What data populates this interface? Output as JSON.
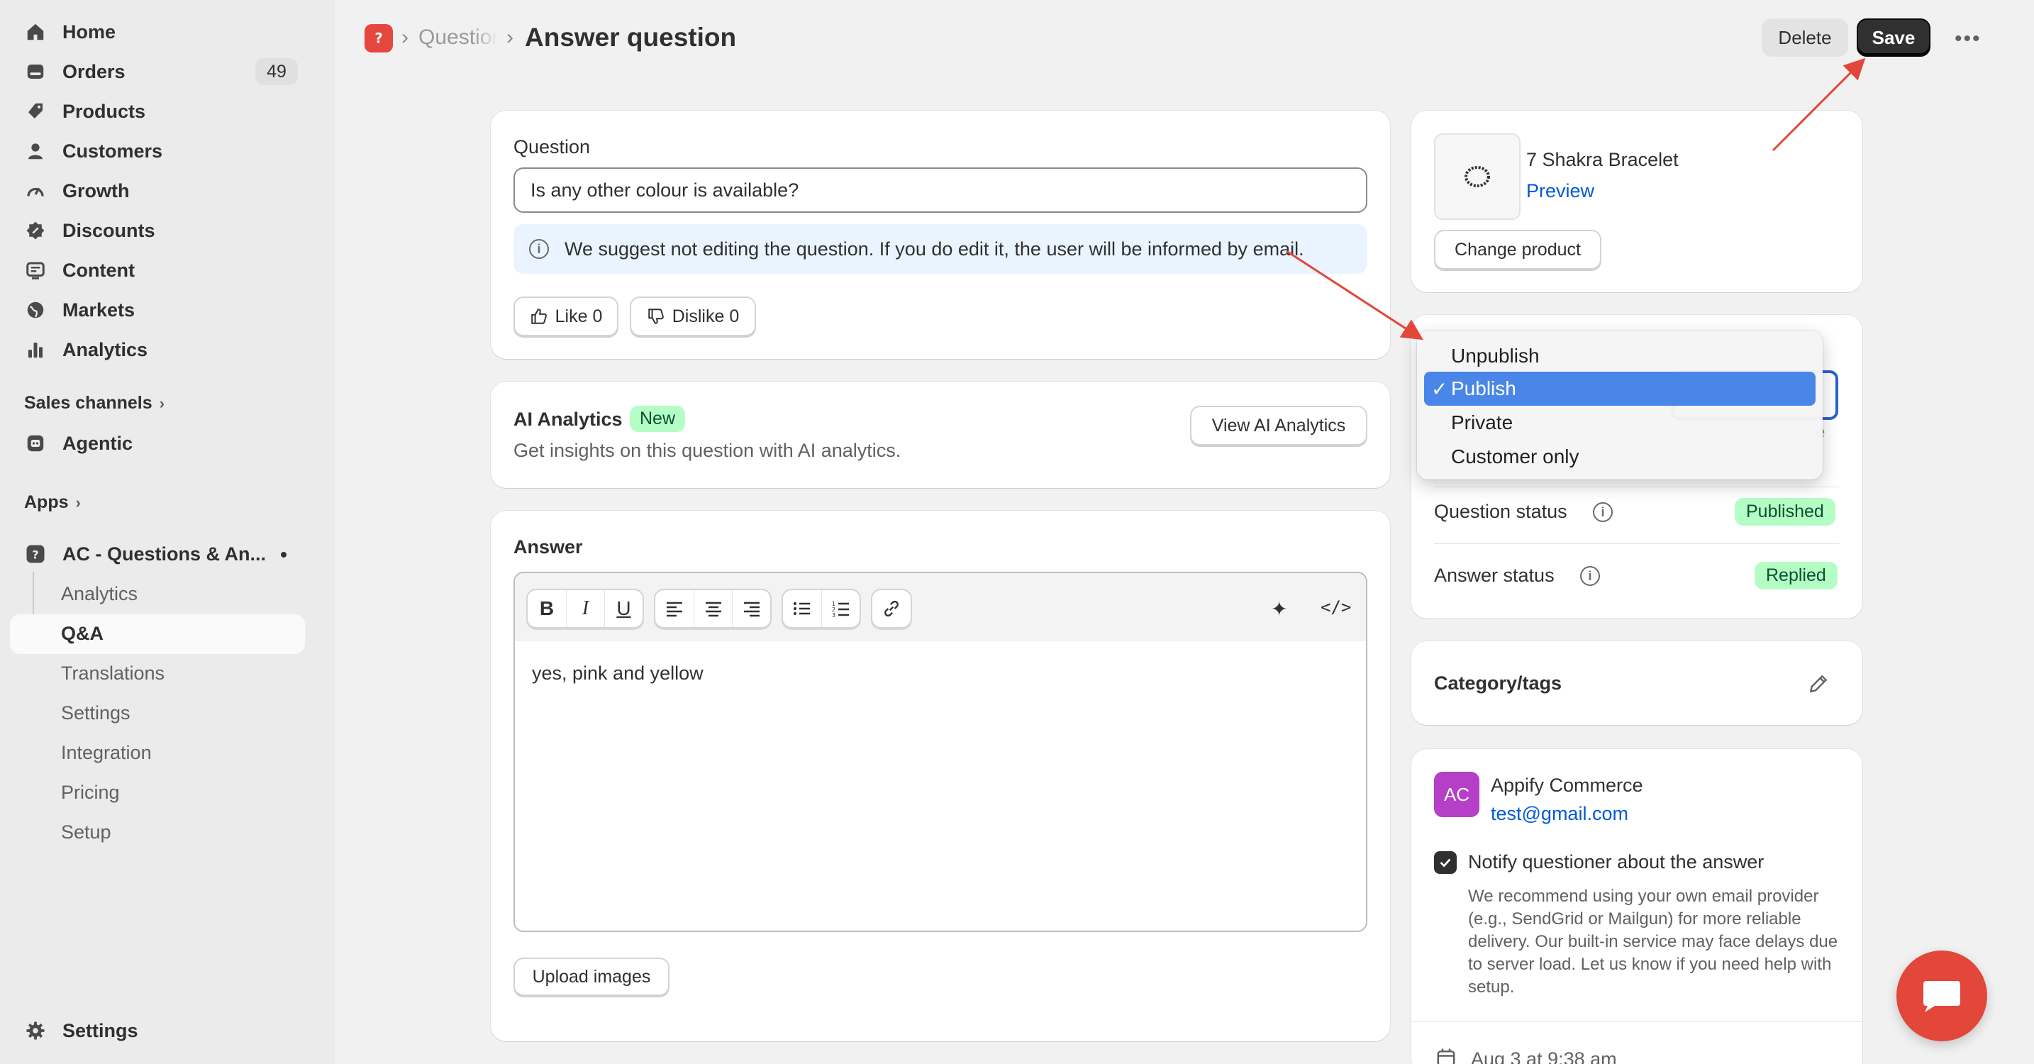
{
  "sidebar": {
    "nav": [
      {
        "label": "Home",
        "icon": "home-icon"
      },
      {
        "label": "Orders",
        "icon": "orders-icon",
        "badge": "49"
      },
      {
        "label": "Products",
        "icon": "tag-icon"
      },
      {
        "label": "Customers",
        "icon": "person-icon"
      },
      {
        "label": "Growth",
        "icon": "gauge-icon"
      },
      {
        "label": "Discounts",
        "icon": "discount-icon"
      },
      {
        "label": "Content",
        "icon": "content-icon"
      },
      {
        "label": "Markets",
        "icon": "globe-icon"
      },
      {
        "label": "Analytics",
        "icon": "bar-chart-icon"
      }
    ],
    "sales_channels_label": "Sales channels",
    "agentic_label": "Agentic",
    "apps_label": "Apps",
    "app_name": "AC - Questions & An...",
    "app_sub": [
      "Analytics",
      "Q&A",
      "Translations",
      "Settings",
      "Integration",
      "Pricing",
      "Setup"
    ],
    "settings_label": "Settings"
  },
  "header": {
    "breadcrumb": "Questions",
    "title": "Answer question",
    "delete_label": "Delete",
    "save_label": "Save"
  },
  "question_card": {
    "label": "Question",
    "value": "Is any other colour is available?",
    "banner": "We suggest not editing the question. If you do edit it, the user will be informed by email.",
    "like_label": "Like 0",
    "dislike_label": "Dislike 0"
  },
  "ai_card": {
    "title": "AI Analytics",
    "badge": "New",
    "description": "Get insights on this question with AI analytics.",
    "button": "View AI Analytics"
  },
  "answer_card": {
    "label": "Answer",
    "content": "yes, pink and yellow",
    "upload_label": "Upload images"
  },
  "product_card": {
    "name": "7 Shakra Bracelet",
    "preview": "Preview",
    "change_label": "Change product"
  },
  "status_card": {
    "dropdown_options": [
      "Unpublish",
      "Publish",
      "Private",
      "Customer only"
    ],
    "selected": "Publish",
    "question_status_label": "Question status",
    "question_status": "Published",
    "answer_status_label": "Answer status",
    "answer_status": "Replied"
  },
  "category_card": {
    "title": "Category/tags"
  },
  "user_card": {
    "initials": "AC",
    "name": "Appify Commerce",
    "email": "test@gmail.com",
    "notify_label": "Notify questioner about the answer",
    "notify_help": "We recommend using your own email provider (e.g., SendGrid or Mailgun) for more reliable delivery. Our built-in service may face delays due to server load. Let us know if you need help with setup.",
    "date": "Aug 3 at 9:38 am"
  },
  "colors": {
    "accent": "#303030",
    "link": "#005bd3",
    "success_bg": "#b4fec5",
    "annotation_arrow": "#e2473a",
    "selection": "#4a86e8"
  }
}
